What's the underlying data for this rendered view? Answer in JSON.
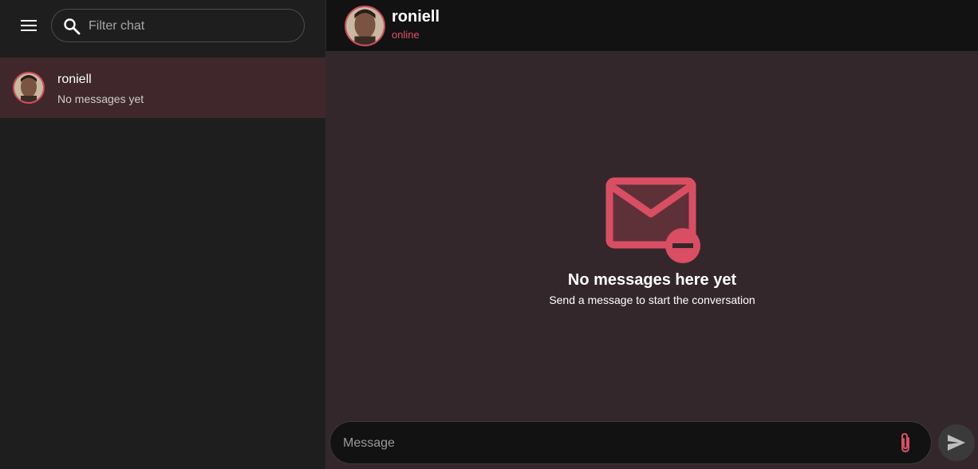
{
  "sidebar": {
    "search": {
      "placeholder": "Filter chat",
      "value": ""
    },
    "chats": [
      {
        "name": "roniell",
        "preview": "No messages yet"
      }
    ]
  },
  "conversation": {
    "contact_name": "roniell",
    "status": "online",
    "empty_title": "No messages here yet",
    "empty_subtitle": "Send a message to start the conversation"
  },
  "composer": {
    "placeholder": "Message",
    "value": ""
  },
  "colors": {
    "accent": "#d94e63",
    "sidebar_bg": "#1e1e1e",
    "selected_chat_bg": "#3f272b",
    "chat_bg": "#33272b",
    "topbar_bg": "#121212"
  },
  "icons": {
    "menu": "menu-icon",
    "search": "search-icon",
    "empty": "mail-minus-icon",
    "attach": "paperclip-icon",
    "send": "send-icon"
  }
}
